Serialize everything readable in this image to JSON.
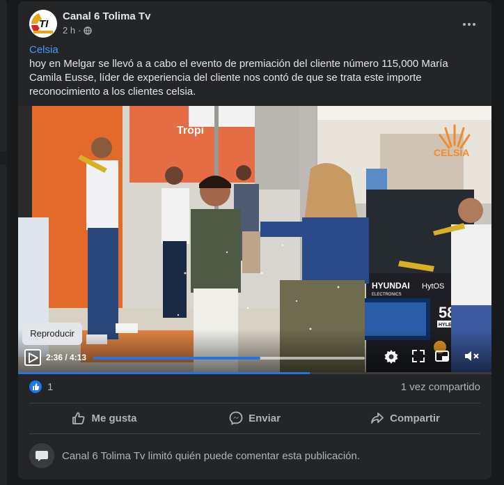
{
  "post": {
    "author": "Canal 6 Tolima Tv",
    "time": "2 h",
    "more_icon": "more-horizontal-icon",
    "audience_icon": "globe-icon",
    "tag": "Celsia",
    "body": "hoy en Melgar se llevó a a cabo el evento de premiación del cliente número 115,000  María Camila Eusse, líder de experiencia del cliente nos contó de que se trata este importe reconocimiento a los clientes celsia."
  },
  "avatar": {
    "logo_text": "TI"
  },
  "video": {
    "tooltip": "Reproducir",
    "time": "2:36 / 4:13",
    "progress_fraction": 0.616,
    "watermark": "CELSIA",
    "storefront_sign": "Tropi",
    "tv_brand": "HYUNDAI",
    "tv_brand_sub": "ELECTRONICS",
    "tv_os": "HytOS",
    "tv_size": "58\"",
    "tv_size_sub": "147",
    "tv_model": "HYLED58",
    "controls": [
      "play-icon",
      "settings-icon",
      "fullscreen-icon",
      "miniplayer-icon",
      "volume-muted-icon"
    ]
  },
  "reactions": {
    "likes": "1",
    "shares": "1 vez compartido"
  },
  "actions": [
    {
      "label": "Me gusta",
      "icon": "thumbs-up-icon"
    },
    {
      "label": "Enviar",
      "icon": "messenger-icon"
    },
    {
      "label": "Compartir",
      "icon": "share-icon"
    }
  ],
  "comments_notice": {
    "text": "Canal 6 Tolima Tv limitó quién puede comentar esta publicación.",
    "icon": "comment-bubble-icon"
  },
  "colors": {
    "accent": "#2374e1",
    "link": "#4599ff",
    "card": "#242526",
    "background": "#18191a"
  }
}
